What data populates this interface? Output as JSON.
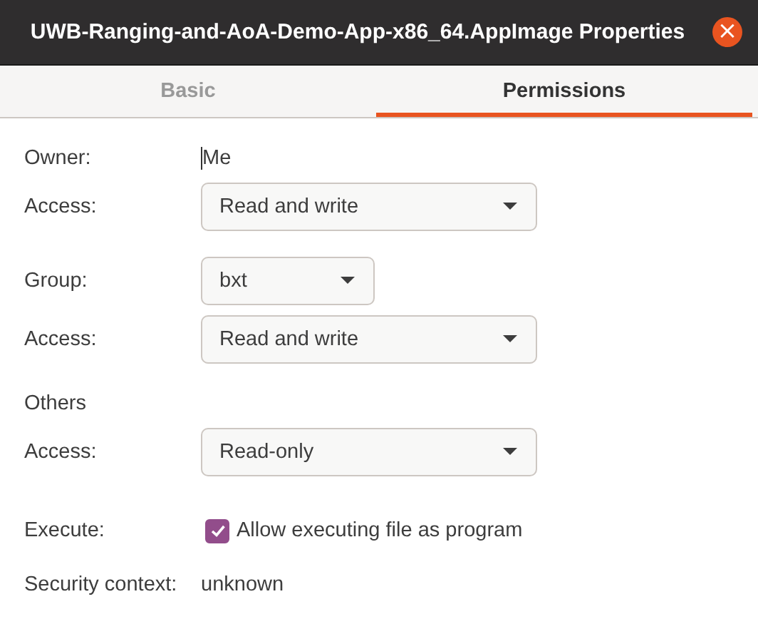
{
  "window": {
    "title": "UWB-Ranging-and-AoA-Demo-App-x86_64.AppImage Properties",
    "close": "×"
  },
  "tabs": [
    {
      "label": "Basic",
      "selected": false
    },
    {
      "label": "Permissions",
      "selected": true
    }
  ],
  "sections": [
    {
      "rows": [
        {
          "kind": "text",
          "label": "Owner:",
          "value": "Me"
        },
        {
          "kind": "dropdown",
          "label": "Access:",
          "value": "Read and write"
        }
      ]
    },
    {
      "rows": [
        {
          "kind": "combo",
          "label": "Group:",
          "value": "bxt"
        },
        {
          "kind": "dropdown",
          "label": "Access:",
          "value": "Read and write"
        }
      ]
    },
    {
      "rows": [
        {
          "kind": "heading",
          "label": "Others"
        },
        {
          "kind": "dropdown",
          "label": "Access:",
          "value": "Read-only"
        }
      ]
    },
    {
      "rows": [
        {
          "kind": "checkbox",
          "label": "Execute:",
          "value": "Allow executing file as program",
          "checked": true
        }
      ]
    },
    {
      "rows": [
        {
          "kind": "text",
          "label": "Security context:",
          "value": "unknown"
        }
      ]
    }
  ]
}
